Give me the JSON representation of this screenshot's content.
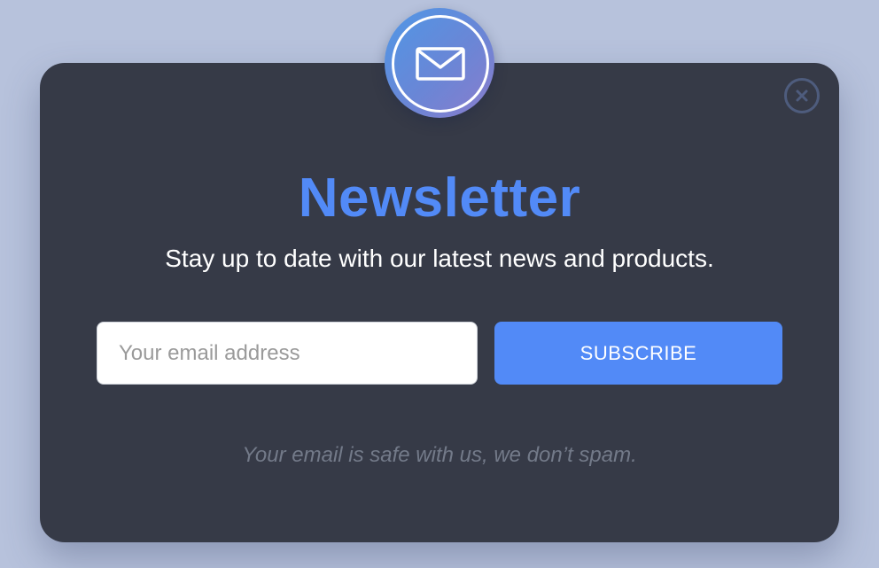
{
  "newsletter": {
    "title": "Newsletter",
    "subtitle": "Stay up to date with our latest news and products.",
    "email_placeholder": "Your email address",
    "email_value": "",
    "subscribe_label": "SUBSCRIBE",
    "privacy_note": "Your email is safe with us, we don’t spam."
  },
  "icons": {
    "badge": "envelope-icon",
    "close": "close-icon"
  },
  "colors": {
    "background": "#b7c2dc",
    "modal": "#363a47",
    "accent": "#528af7",
    "badge_gradient_start": "#4f97e6",
    "badge_gradient_end": "#8a7ccc",
    "close_ring": "#4e5c7d",
    "note_text": "#737a89"
  }
}
